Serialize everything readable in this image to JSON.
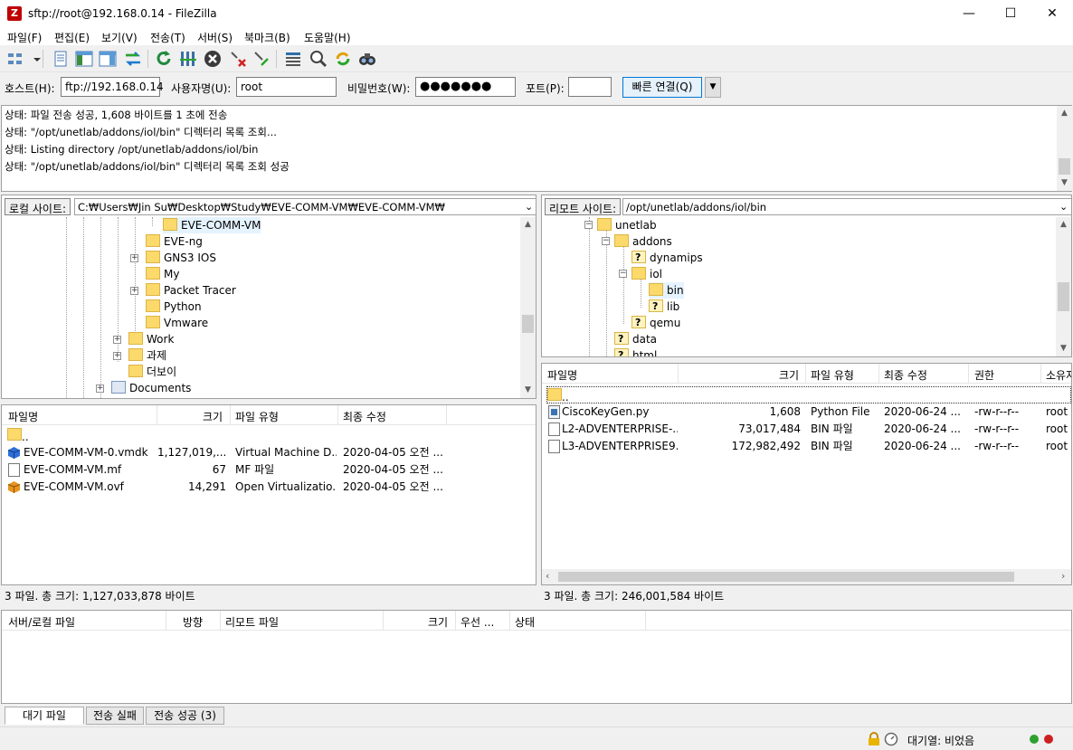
{
  "window": {
    "title": "sftp://root@192.168.0.14 - FileZilla",
    "app_icon": "Z"
  },
  "menu": [
    "파일(F)",
    "편집(E)",
    "보기(V)",
    "전송(T)",
    "서버(S)",
    "북마크(B)",
    "도움말(H)"
  ],
  "quickconnect": {
    "host_label": "호스트(H):",
    "host_value": "ftp://192.168.0.14",
    "user_label": "사용자명(U):",
    "user_value": "root",
    "pass_label": "비밀번호(W):",
    "pass_value": "●●●●●●●",
    "port_label": "포트(P):",
    "port_value": "",
    "connect_label": "빠른 연결(Q)"
  },
  "log": [
    "상태: 파일 전송 성공, 1,608 바이트를 1 초에 전송",
    "상태: \"/opt/unetlab/addons/iol/bin\" 디렉터리 목록 조회...",
    "상태: Listing directory /opt/unetlab/addons/iol/bin",
    "상태: \"/opt/unetlab/addons/iol/bin\" 디렉터리 목록 조회 성공"
  ],
  "local": {
    "site_label": "로컬 사이트:",
    "path": "C:₩Users₩Jin Su₩Desktop₩Study₩EVE-COMM-VM₩EVE-COMM-VM₩",
    "tree": [
      "EVE-COMM-VM",
      "EVE-ng",
      "GNS3 IOS",
      "My",
      "Packet Tracer",
      "Python",
      "Vmware",
      "Work",
      "과제",
      "더보이",
      "Documents"
    ],
    "headers": [
      "파일명",
      "크기",
      "파일 유형",
      "최종 수정"
    ],
    "files": [
      {
        "name": "..",
        "size": "",
        "type": "",
        "modified": ""
      },
      {
        "name": "EVE-COMM-VM-0.vmdk",
        "size": "1,127,019,...",
        "type": "Virtual Machine D...",
        "modified": "2020-04-05 오전 ..."
      },
      {
        "name": "EVE-COMM-VM.mf",
        "size": "67",
        "type": "MF 파일",
        "modified": "2020-04-05 오전 ..."
      },
      {
        "name": "EVE-COMM-VM.ovf",
        "size": "14,291",
        "type": "Open Virtualizatio...",
        "modified": "2020-04-05 오전 ..."
      }
    ],
    "status": "3 파일. 총 크기: 1,127,033,878 바이트"
  },
  "remote": {
    "site_label": "리모트 사이트:",
    "path": "/opt/unetlab/addons/iol/bin",
    "tree": [
      "unetlab",
      "addons",
      "dynamips",
      "iol",
      "bin",
      "lib",
      "qemu",
      "data",
      "html"
    ],
    "headers": [
      "파일명",
      "크기",
      "파일 유형",
      "최종 수정",
      "권한",
      "소유자"
    ],
    "files": [
      {
        "name": "..",
        "size": "",
        "type": "",
        "modified": "",
        "perm": "",
        "owner": ""
      },
      {
        "name": "CiscoKeyGen.py",
        "size": "1,608",
        "type": "Python File",
        "modified": "2020-06-24 ...",
        "perm": "-rw-r--r--",
        "owner": "root"
      },
      {
        "name": "L2-ADVENTERPRISE-...",
        "size": "73,017,484",
        "type": "BIN 파일",
        "modified": "2020-06-24 ...",
        "perm": "-rw-r--r--",
        "owner": "root"
      },
      {
        "name": "L3-ADVENTERPRISE9...",
        "size": "172,982,492",
        "type": "BIN 파일",
        "modified": "2020-06-24 ...",
        "perm": "-rw-r--r--",
        "owner": "root"
      }
    ],
    "status": "3 파일. 총 크기: 246,001,584 바이트"
  },
  "queue": {
    "headers": [
      "서버/로컬 파일",
      "방향",
      "리모트 파일",
      "크기",
      "우선 ...",
      "상태"
    ],
    "tabs": [
      "대기 파일",
      "전송 실패",
      "전송 성공 (3)"
    ],
    "status": "대기열: 비었음"
  },
  "colors": {
    "accent": "#0078d7",
    "folder": "#fcd96b",
    "selected": "#e5f3ff"
  }
}
